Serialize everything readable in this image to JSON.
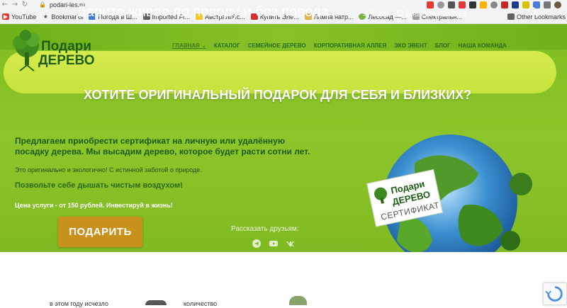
{
  "browser": {
    "url": "podari-les.ru",
    "bookmarks": [
      {
        "label": "YouTube",
        "icon": "youtube-icon"
      },
      {
        "label": "Bookmarks",
        "icon": "star-icon"
      },
      {
        "label": "Погода в Ш...",
        "icon": "weather-icon"
      },
      {
        "label": "Imported Fr...",
        "icon": "folder-icon"
      },
      {
        "label": "Австралийс...",
        "icon": "shield-icon"
      },
      {
        "label": "Купить Эле...",
        "icon": "shop-icon"
      },
      {
        "label": "Лампа натр...",
        "icon": "lamp-icon"
      },
      {
        "label": "Лесосад —...",
        "icon": "leaf-icon"
      },
      {
        "label": "Спектральн...",
        "icon": "page-icon"
      }
    ],
    "other_bookmarks": "Other bookmarks"
  },
  "header": {
    "tagline": "Дарите живое по поводу и без повода",
    "login": "Войти",
    "register": "Зарегистрироваться"
  },
  "logo": {
    "line1": "Подари",
    "line2": "ДЕРЕВО"
  },
  "menu": [
    {
      "label": "ГЛАВНАЯ"
    },
    {
      "label": "КАТАЛОГ"
    },
    {
      "label": "СЕМЕЙНОЕ ДЕРЕВО"
    },
    {
      "label": "КОРПОРАТИВНАЯ АЛЛЕЯ"
    },
    {
      "label": "ЭКО ЭВЕНТ"
    },
    {
      "label": "БЛОГ"
    },
    {
      "label": "НАША КОМАНДА"
    }
  ],
  "hero": {
    "headline": "ХОТИТЕ ОРИГИНАЛЬНЫЙ ПОДАРОК ДЛЯ СЕБЯ И БЛИЗКИХ?",
    "p1": "Предлагаем приобрести сертификат на личную или удалённую посадку дерева. Мы высадим дерево, которое  будет расти сотни лет.",
    "p2": "Это оригинально и экологично! С истинной заботой о природе.",
    "p3": "Позвольте себе дышать чистым воздухом!",
    "p4": "Цена услуги - от 150 рублей. Инвестируй в жизнь!",
    "button": "ПОДАРИТЬ",
    "share": "Рассказать друзьям:",
    "cert_line1": "Подари",
    "cert_line2": "ДЕРЕВО",
    "cert_line3": "СЕРТИФИКАТ"
  },
  "bottom": {
    "col1": "в этом году исчезло",
    "col2": "количество"
  },
  "colors": {
    "brand_green": "#7fbd1f",
    "button": "#c7911b",
    "logo_text": "#1d5d14"
  }
}
